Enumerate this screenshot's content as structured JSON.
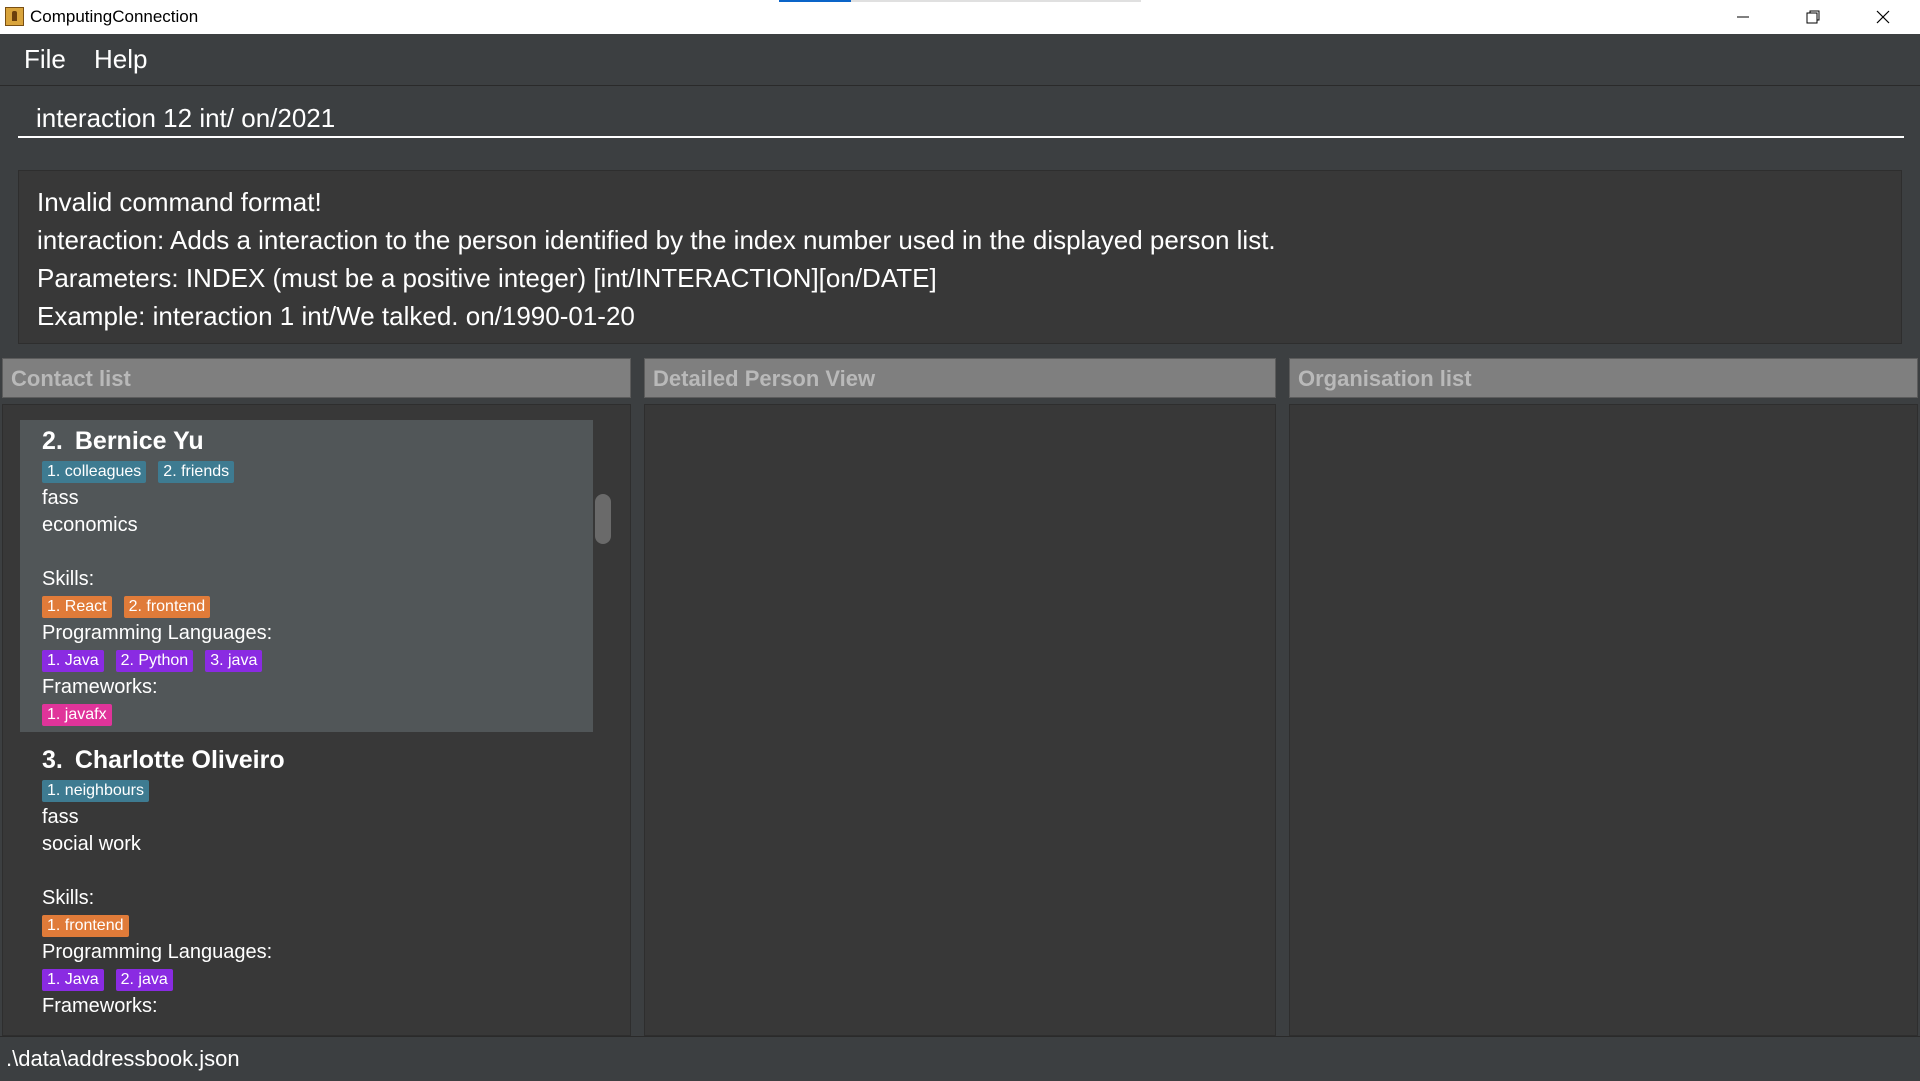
{
  "window": {
    "title": "ComputingConnection"
  },
  "menu": {
    "file": "File",
    "help": "Help"
  },
  "command": {
    "value": "interaction 12 int/ on/2021"
  },
  "result": {
    "lines": [
      "Invalid command format!",
      "interaction: Adds a interaction to the person identified by the index number used in the displayed person list.",
      "Parameters: INDEX (must be a positive integer) [int/INTERACTION][on/DATE]",
      "Example: interaction 1 int/We talked. on/1990-01-20"
    ]
  },
  "panels": {
    "contact_list": "Contact list",
    "detailed_view": "Detailed Person View",
    "organisation_list": "Organisation list"
  },
  "persons": [
    {
      "index": "2.",
      "name": "Bernice Yu",
      "groups": [
        "1. colleagues",
        "2. friends"
      ],
      "faculty": "fass",
      "major": "economics",
      "skills_label": "Skills:",
      "skills": [
        "1. React",
        "2. frontend"
      ],
      "languages_label": "Programming Languages:",
      "languages": [
        "1. Java",
        "2. Python",
        "3. java"
      ],
      "frameworks_label": "Frameworks:",
      "frameworks": [
        "1. javafx"
      ]
    },
    {
      "index": "3.",
      "name": "Charlotte Oliveiro",
      "groups": [
        "1. neighbours"
      ],
      "faculty": "fass",
      "major": "social work",
      "skills_label": "Skills:",
      "skills": [
        "1. frontend"
      ],
      "languages_label": "Programming Languages:",
      "languages": [
        "1. Java",
        "2. java"
      ],
      "frameworks_label": "Frameworks:",
      "frameworks": [
        ""
      ]
    }
  ],
  "status": {
    "path": ".\\data\\addressbook.json"
  },
  "colors": {
    "background": "#3c3f41",
    "group_tag": "#3e7b91",
    "skill_tag": "#e07b39",
    "language_tag": "#8a2be2",
    "framework_tag": "#e0349a"
  }
}
